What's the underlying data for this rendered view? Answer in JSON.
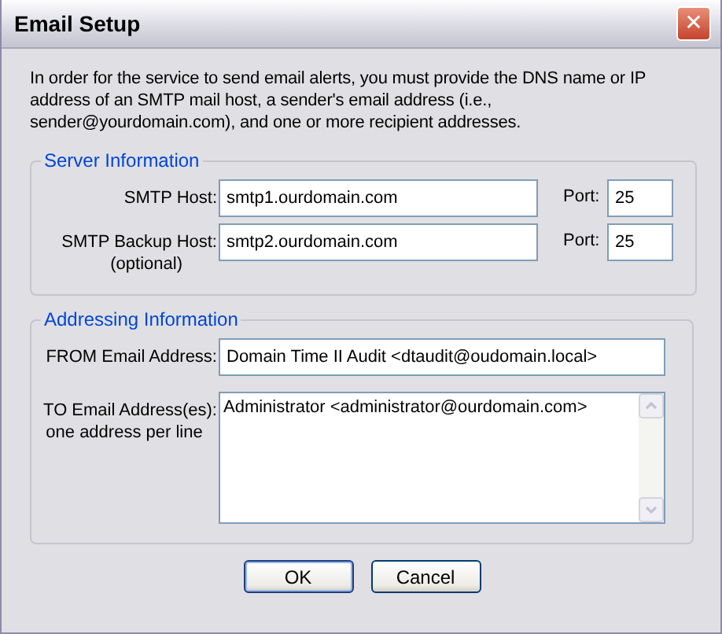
{
  "window": {
    "title": "Email Setup",
    "close_label": "✕"
  },
  "intro": "In order for the service to send email alerts, you must provide the DNS name or IP address of an SMTP mail host, a sender's email address (i.e., sender@yourdomain.com), and one or more recipient addresses.",
  "server_group": {
    "legend": "Server Information",
    "rows": [
      {
        "label": "SMTP Host:",
        "note": null,
        "value": "smtp1.ourdomain.com",
        "port_label": "Port:",
        "port": "25"
      },
      {
        "label": "SMTP Backup Host:",
        "note": "(optional)",
        "value": "smtp2.ourdomain.com",
        "port_label": "Port:",
        "port": "25"
      }
    ]
  },
  "addressing_group": {
    "legend": "Addressing Information",
    "from": {
      "label": "FROM Email Address:",
      "value": "Domain Time II Audit <dtaudit@oudomain.local>"
    },
    "to": {
      "label": "TO Email Address(es):",
      "note": "one address per line",
      "value": "Administrator <administrator@ourdomain.com>"
    }
  },
  "buttons": [
    {
      "label": "OK",
      "default": true
    },
    {
      "label": "Cancel",
      "default": false
    }
  ]
}
